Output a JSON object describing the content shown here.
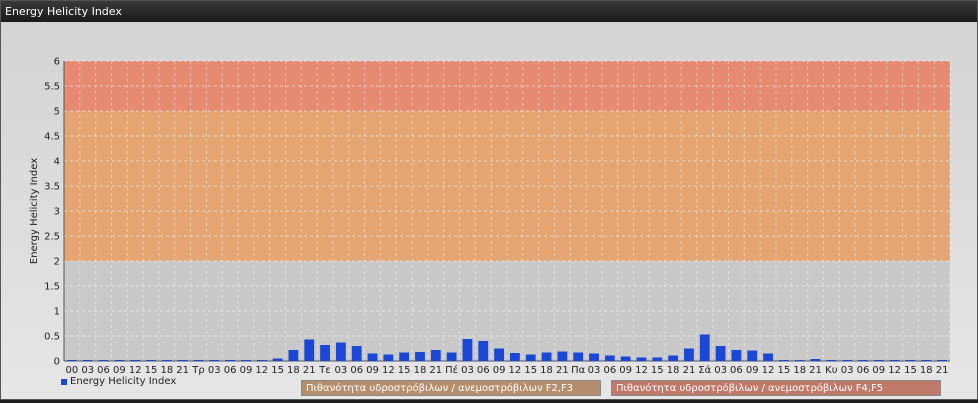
{
  "window": {
    "title": "Energy Helicity Index"
  },
  "legend": {
    "series_label": "Energy Helicity Index"
  },
  "bands": {
    "f23_label": "Πιθανότητα υδροστρόβιλων / ανεμοστρόβιλων F2,F3",
    "f45_label": "Πιθανότητα υδροστρόβιλων / ανεμοστρόβιλων F4,F5"
  },
  "colors": {
    "bar": "#1a47d6",
    "band_low": "#c9c9c9",
    "band_mid": "#e4a572",
    "band_high": "#e68a72"
  },
  "chart_data": {
    "type": "bar",
    "title": "",
    "xlabel": "",
    "ylabel": "Energy Helicity Index",
    "ylim": [
      0,
      6
    ],
    "yticks": [
      "0",
      "0.5",
      "1",
      "1.5",
      "2",
      "2.5",
      "3",
      "3.5",
      "4",
      "4.5",
      "5",
      "5.5",
      "6"
    ],
    "grid": true,
    "legend_position": "bottom-left",
    "threshold_bands": [
      {
        "from": 0,
        "to": 2,
        "color": "#c9c9c9"
      },
      {
        "from": 2,
        "to": 5,
        "color": "#e4a572"
      },
      {
        "from": 5,
        "to": 6,
        "color": "#e68a72"
      }
    ],
    "categories": [
      "00",
      "03",
      "06",
      "09",
      "12",
      "15",
      "18",
      "21",
      "Τρ",
      "03",
      "06",
      "09",
      "12",
      "15",
      "18",
      "21",
      "Τε",
      "03",
      "06",
      "09",
      "12",
      "15",
      "18",
      "21",
      "Πέ",
      "03",
      "06",
      "09",
      "12",
      "15",
      "18",
      "21",
      "Πα",
      "03",
      "06",
      "09",
      "12",
      "15",
      "18",
      "21",
      "Σά",
      "03",
      "06",
      "09",
      "12",
      "15",
      "18",
      "21",
      "Κυ",
      "03",
      "06",
      "09",
      "12",
      "15",
      "18",
      "21"
    ],
    "series": [
      {
        "name": "Energy Helicity Index",
        "values": [
          0.02,
          0.02,
          0.02,
          0.02,
          0.02,
          0.02,
          0.02,
          0.02,
          0.02,
          0.02,
          0.02,
          0.02,
          0.02,
          0.05,
          0.22,
          0.43,
          0.32,
          0.37,
          0.3,
          0.15,
          0.13,
          0.17,
          0.18,
          0.22,
          0.17,
          0.44,
          0.4,
          0.25,
          0.16,
          0.13,
          0.17,
          0.19,
          0.17,
          0.15,
          0.11,
          0.09,
          0.07,
          0.07,
          0.11,
          0.25,
          0.53,
          0.3,
          0.22,
          0.21,
          0.15,
          0.02,
          0.02,
          0.04,
          0.02,
          0.02,
          0.02,
          0.02,
          0.02,
          0.02,
          0.02,
          0.02
        ]
      }
    ]
  }
}
